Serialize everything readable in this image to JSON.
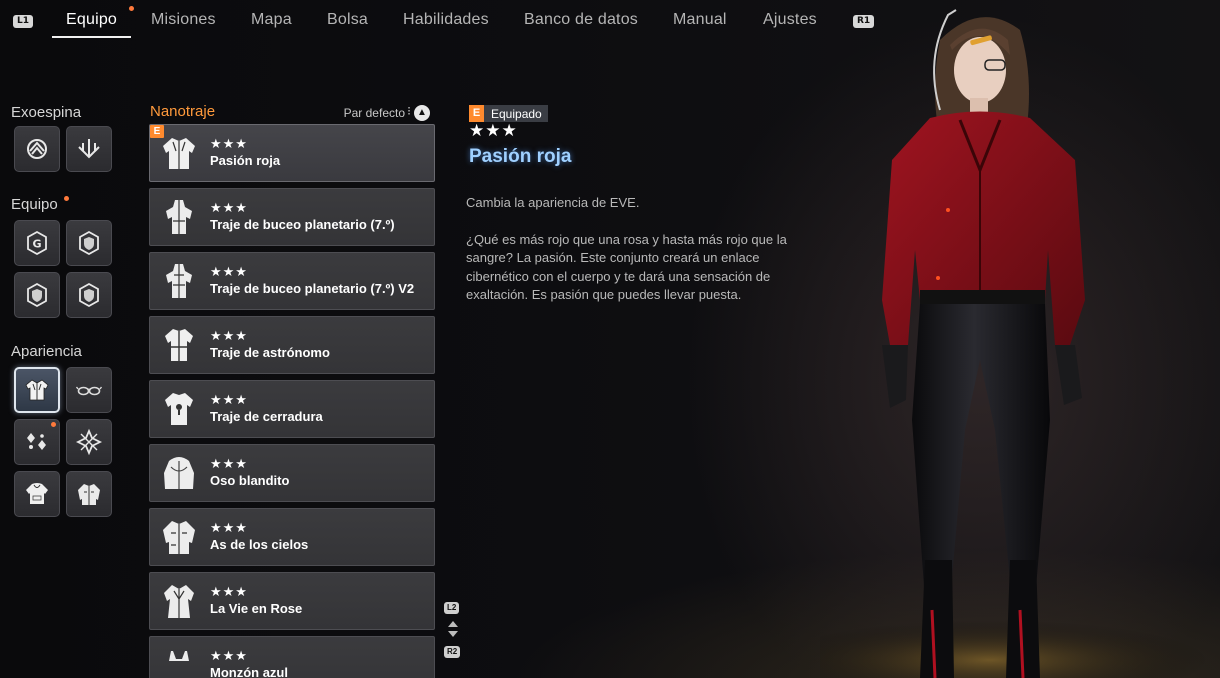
{
  "nav": {
    "left_button": "L1",
    "right_button": "R1",
    "tabs": [
      {
        "label": "Equipo",
        "active": true,
        "notification": true
      },
      {
        "label": "Misiones"
      },
      {
        "label": "Mapa"
      },
      {
        "label": "Bolsa"
      },
      {
        "label": "Habilidades"
      },
      {
        "label": "Banco de datos"
      },
      {
        "label": "Manual"
      },
      {
        "label": "Ajustes"
      }
    ]
  },
  "sidebar": {
    "exoespina": {
      "title": "Exoespina",
      "slots": [
        "exospine-icon-1",
        "exospine-icon-2"
      ]
    },
    "equipo": {
      "title": "Equipo",
      "notification": true,
      "slots": [
        "gear-g-icon",
        "gear-shield-icon",
        "gear-shield-icon",
        "gear-shield-icon"
      ]
    },
    "apariencia": {
      "title": "Apariencia",
      "slots": [
        "suit-icon",
        "glasses-icon",
        "earring-icon",
        "accessory-icon",
        "hoodie-icon",
        "jacket-icon"
      ],
      "selected_index": 0
    }
  },
  "list": {
    "title": "Nanotraje",
    "sort_label": "Par defecto",
    "items": [
      {
        "stars": "★★★",
        "name": "Pasión roja",
        "equipped": true,
        "equipped_badge": "E"
      },
      {
        "stars": "★★★",
        "name": "Traje de buceo planetario (7.º)"
      },
      {
        "stars": "★★★",
        "name": "Traje de buceo planetario (7.º) V2"
      },
      {
        "stars": "★★★",
        "name": "Traje de astrónomo"
      },
      {
        "stars": "★★★",
        "name": "Traje de cerradura"
      },
      {
        "stars": "★★★",
        "name": "Oso blandito"
      },
      {
        "stars": "★★★",
        "name": "As de los cielos"
      },
      {
        "stars": "★★★",
        "name": "La Vie en Rose"
      },
      {
        "stars": "★★★",
        "name": "Monzón azul"
      }
    ],
    "scroll_up_button": "L2",
    "scroll_down_button": "R2"
  },
  "detail": {
    "badge_letter": "E",
    "badge_text": "Equipado",
    "stars": "★★★",
    "title": "Pasión roja",
    "paragraphs": [
      "Cambia la apariencia de EVE.",
      "¿Qué es más rojo que una rosa y hasta más rojo que la sangre? La pasión. Este conjunto creará un enlace cibernético con el cuerpo y te dará una sensación de exaltación. Es pasión que puedes llevar puesta."
    ]
  },
  "colors": {
    "accent": "#ff9a3c",
    "title_glow": "#9fd0ff",
    "badge": "#ff8a2e"
  }
}
